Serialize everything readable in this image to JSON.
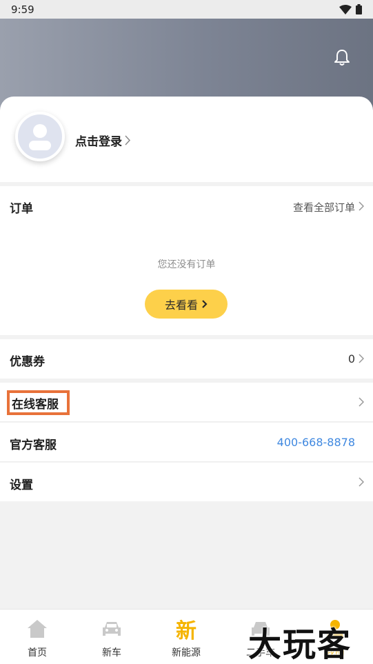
{
  "status": {
    "time": "9:59"
  },
  "profile": {
    "login_label": "点击登录"
  },
  "orders": {
    "title": "订单",
    "view_all": "查看全部订单",
    "empty_text": "您还没有订单",
    "go_button": "去看看"
  },
  "coupon": {
    "title": "优惠券",
    "count": "0"
  },
  "service": {
    "title": "在线客服"
  },
  "hotline": {
    "title": "官方客服",
    "phone": "400-668-8878"
  },
  "settings": {
    "title": "设置"
  },
  "tabs": [
    {
      "label": "首页",
      "icon": "home-icon"
    },
    {
      "label": "新车",
      "icon": "car-icon"
    },
    {
      "label": "新能源",
      "icon": "xin-icon",
      "glyph": "新"
    },
    {
      "label": "二手车",
      "icon": "used-car-icon"
    },
    {
      "label": "我的",
      "icon": "me-icon",
      "active": true
    }
  ],
  "watermark": "大玩客",
  "colors": {
    "accent": "#f5b400",
    "button": "#fdd04a",
    "link": "#3f88e0",
    "highlight": "#e8723a"
  }
}
